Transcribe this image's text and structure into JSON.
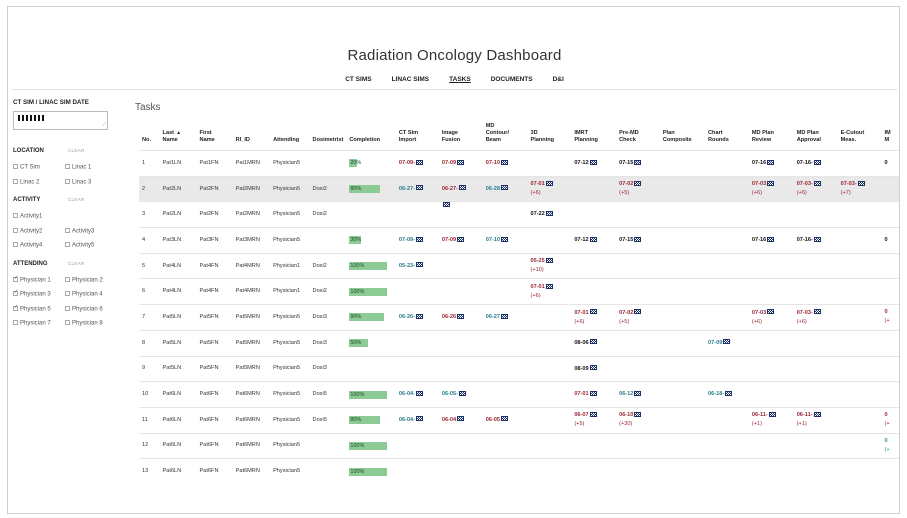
{
  "title": "Radiation Oncology Dashboard",
  "nav": [
    {
      "label": "CT SIMS",
      "active": false
    },
    {
      "label": "LINAC SIMS",
      "active": false
    },
    {
      "label": "TASKS",
      "active": true
    },
    {
      "label": "DOCUMENTS",
      "active": false
    },
    {
      "label": "D&I",
      "active": false
    }
  ],
  "sidebar": {
    "date_heading": "CT SIM / LINAC SIM DATE",
    "location": {
      "title": "LOCATION",
      "clear": "CLEAR",
      "options": [
        {
          "label": "CT Sim",
          "checked": false
        },
        {
          "label": "Linac 1",
          "checked": false
        },
        {
          "label": "Linac 2",
          "checked": false
        },
        {
          "label": "Linac 3",
          "checked": false
        }
      ]
    },
    "activity": {
      "title": "ACTIVITY",
      "clear": "CLEAR",
      "options": [
        {
          "label": "Activity1",
          "checked": false
        },
        {
          "label": "",
          "checked": null
        },
        {
          "label": "Activity2",
          "checked": false
        },
        {
          "label": "Activity3",
          "checked": false
        },
        {
          "label": "Activity4",
          "checked": false
        },
        {
          "label": "Activity5",
          "checked": false
        }
      ]
    },
    "attending": {
      "title": "ATTENDING",
      "clear": "CLEAR",
      "options": [
        {
          "label": "Physician 1",
          "checked": true
        },
        {
          "label": "Physician 2",
          "checked": false
        },
        {
          "label": "Physician 3",
          "checked": true
        },
        {
          "label": "Physician 4",
          "checked": false
        },
        {
          "label": "Physician 5",
          "checked": true
        },
        {
          "label": "Physician 6",
          "checked": false
        },
        {
          "label": "Physician 7",
          "checked": false
        },
        {
          "label": "Physician 8",
          "checked": false
        }
      ]
    }
  },
  "main": {
    "heading": "Tasks",
    "columns": [
      {
        "key": "no",
        "label": [
          "No."
        ],
        "w": 21
      },
      {
        "key": "last",
        "label": [
          "Last",
          "Name"
        ],
        "w": 38,
        "sort": "▲"
      },
      {
        "key": "first",
        "label": [
          "First",
          "Name"
        ],
        "w": 37
      },
      {
        "key": "ri",
        "label": [
          "RI_ID"
        ],
        "w": 38
      },
      {
        "key": "att",
        "label": [
          "Attending"
        ],
        "w": 40
      },
      {
        "key": "dosi",
        "label": [
          "Dosimetrist"
        ],
        "w": 36
      },
      {
        "key": "comp",
        "label": [
          "Completion"
        ],
        "w": 50
      },
      {
        "key": "ctsim",
        "label": [
          "CT Sim",
          "Import"
        ],
        "w": 44
      },
      {
        "key": "imgfus",
        "label": [
          "Image",
          "Fusion"
        ],
        "w": 45
      },
      {
        "key": "mdcont",
        "label": [
          "MD",
          "Contour/",
          "Beam"
        ],
        "w": 46
      },
      {
        "key": "plan3d",
        "label": [
          "3D",
          "Planning"
        ],
        "w": 45
      },
      {
        "key": "imrt",
        "label": [
          "IMRT",
          "Planning"
        ],
        "w": 46
      },
      {
        "key": "premd",
        "label": [
          "Pre-MD",
          "Check"
        ],
        "w": 45
      },
      {
        "key": "plancomp",
        "label": [
          "Plan",
          "Composite"
        ],
        "w": 46
      },
      {
        "key": "chart",
        "label": [
          "Chart",
          "Rounds"
        ],
        "w": 45
      },
      {
        "key": "mdreview",
        "label": [
          "MD Plan",
          "Review"
        ],
        "w": 46
      },
      {
        "key": "mdapprove",
        "label": [
          "MD Plan",
          "Approval"
        ],
        "w": 45
      },
      {
        "key": "ecut",
        "label": [
          "E-Cutout",
          "Meas."
        ],
        "w": 45
      },
      {
        "key": "im",
        "label": [
          "IM",
          "M"
        ],
        "w": 20
      }
    ],
    "rows": [
      {
        "shaded": false,
        "no": "1",
        "last": "Pat1LN",
        "first": "Pat1FN",
        "ri": "Pat1MRN",
        "att": "Physician5",
        "dosi": "",
        "comp": 20,
        "ctsim": {
          "d": "07-09-",
          "c": "red",
          "i": true
        },
        "imgfus": {
          "d": "07-09",
          "c": "red",
          "i": true
        },
        "mdcont": {
          "d": "07-10",
          "c": "red",
          "i": true
        },
        "imrt": {
          "d": "07-12",
          "c": "black",
          "i": true
        },
        "premd": {
          "d": "07-15",
          "c": "black",
          "i": true
        },
        "mdreview": {
          "d": "07-16",
          "c": "black",
          "i": true
        },
        "mdapprove": {
          "d": "07-16-",
          "c": "black",
          "i": true
        },
        "im": {
          "d": "0",
          "c": "black"
        }
      },
      {
        "shaded": true,
        "no": "2",
        "last": "Pat2LN",
        "first": "Pat2FN",
        "ri": "Pat2MRN",
        "att": "Physician5",
        "dosi": "Dosi2",
        "comp": 80,
        "ctsim": {
          "d": "06-27-",
          "c": "teal",
          "i": true
        },
        "imgfus": {
          "d": "06-27-",
          "c": "red",
          "i": true
        },
        "mdcont": {
          "d": "06-28",
          "c": "teal",
          "i": true
        },
        "plan3d": {
          "d": "07-01",
          "c": "red",
          "i": true,
          "s": "(+6)"
        },
        "premd": {
          "d": "07-02",
          "c": "red",
          "i": true,
          "s": "(+5)"
        },
        "mdreview": {
          "d": "07-03",
          "c": "red",
          "i": true,
          "s": "(+6)"
        },
        "mdapprove": {
          "d": "07-03-",
          "c": "red",
          "i": true,
          "s": "(+6)"
        },
        "ecut": {
          "d": "07-03-",
          "c": "red",
          "i": true,
          "s": "(+7)"
        }
      },
      {
        "shaded": false,
        "no": "3",
        "last": "Pat2LN",
        "first": "Pat2FN",
        "ri": "Pat2MRN",
        "att": "Physician5",
        "dosi": "Dosi2",
        "comp": null,
        "imgfus": {
          "d": "",
          "c": "black",
          "i": true,
          "top": true
        },
        "plan3d": {
          "d": "07-22",
          "c": "black",
          "i": true
        }
      },
      {
        "shaded": false,
        "no": "4",
        "last": "Pat3LN",
        "first": "Pat3FN",
        "ri": "Pat3MRN",
        "att": "Physician5",
        "dosi": "",
        "comp": 30,
        "ctsim": {
          "d": "07-09-",
          "c": "teal",
          "i": true
        },
        "imgfus": {
          "d": "07-09",
          "c": "red",
          "i": true
        },
        "mdcont": {
          "d": "07-10",
          "c": "teal",
          "i": true
        },
        "imrt": {
          "d": "07-12",
          "c": "black",
          "i": true
        },
        "premd": {
          "d": "07-15",
          "c": "black",
          "i": true
        },
        "mdreview": {
          "d": "07-16",
          "c": "black",
          "i": true
        },
        "mdapprove": {
          "d": "07-16-",
          "c": "black",
          "i": true
        },
        "im": {
          "d": "0",
          "c": "black"
        }
      },
      {
        "shaded": false,
        "no": "5",
        "last": "Pat4LN",
        "first": "Pat4FN",
        "ri": "Pat4MRN",
        "att": "Physician1",
        "dosi": "Dosi2",
        "comp": 100,
        "ctsim": {
          "d": "05-23-",
          "c": "teal",
          "i": true
        },
        "plan3d": {
          "d": "05-25",
          "c": "red",
          "i": true,
          "s": "(+10)"
        }
      },
      {
        "shaded": false,
        "no": "6",
        "last": "Pat4LN",
        "first": "Pat4FN",
        "ri": "Pat4MRN",
        "att": "Physician1",
        "dosi": "Dosi2",
        "comp": 100,
        "plan3d": {
          "d": "07-01",
          "c": "red",
          "i": true,
          "s": "(+6)"
        }
      },
      {
        "shaded": false,
        "no": "7",
        "last": "Pat5LN",
        "first": "Pat5FN",
        "ri": "Pat5MRN",
        "att": "Physician5",
        "dosi": "Dosi3",
        "comp": 90,
        "ctsim": {
          "d": "06-26-",
          "c": "teal",
          "i": true
        },
        "imgfus": {
          "d": "06-26",
          "c": "red",
          "i": true
        },
        "mdcont": {
          "d": "06-27",
          "c": "teal",
          "i": true
        },
        "imrt": {
          "d": "07-01",
          "c": "red",
          "i": true,
          "s": "(+6)"
        },
        "premd": {
          "d": "07-02",
          "c": "red",
          "i": true,
          "s": "(+5)"
        },
        "mdreview": {
          "d": "07-03",
          "c": "red",
          "i": true,
          "s": "(+6)"
        },
        "mdapprove": {
          "d": "07-03-",
          "c": "red",
          "i": true,
          "s": "(+6)"
        },
        "im": {
          "d": "0",
          "c": "red",
          "s": "(+"
        }
      },
      {
        "shaded": false,
        "no": "8",
        "last": "Pat5LN",
        "first": "Pat5FN",
        "ri": "Pat5MRN",
        "att": "Physician5",
        "dosi": "Dosi3",
        "comp": 50,
        "imrt": {
          "d": "08-06",
          "c": "black",
          "i": true
        },
        "chart": {
          "d": "07-09",
          "c": "teal",
          "i": true
        }
      },
      {
        "shaded": false,
        "no": "9",
        "last": "Pat5LN",
        "first": "Pat5FN",
        "ri": "Pat5MRN",
        "att": "Physician5",
        "dosi": "Dosi3",
        "comp": null,
        "imrt": {
          "d": "08-09",
          "c": "black",
          "i": true
        }
      },
      {
        "shaded": false,
        "no": "10",
        "last": "Pat6LN",
        "first": "Pat6FN",
        "ri": "Pat6MRN",
        "att": "Physician5",
        "dosi": "Dosi5",
        "comp": 100,
        "ctsim": {
          "d": "06-04-",
          "c": "teal",
          "i": true
        },
        "imgfus": {
          "d": "06-05-",
          "c": "teal",
          "i": true
        },
        "imrt": {
          "d": "07-01",
          "c": "red",
          "i": true
        },
        "premd": {
          "d": "06-12",
          "c": "teal",
          "i": true
        },
        "chart": {
          "d": "06-18-",
          "c": "teal",
          "i": true
        }
      },
      {
        "shaded": false,
        "no": "11",
        "last": "Pat6LN",
        "first": "Pat6FN",
        "ri": "Pat6MRN",
        "att": "Physician5",
        "dosi": "Dosi5",
        "comp": 80,
        "ctsim": {
          "d": "06-04-",
          "c": "teal",
          "i": true
        },
        "imgfus": {
          "d": "06-04",
          "c": "red",
          "i": true
        },
        "mdcont": {
          "d": "06-05",
          "c": "red",
          "i": true
        },
        "imrt": {
          "d": "06-07",
          "c": "red",
          "i": true,
          "s": "(+5)"
        },
        "premd": {
          "d": "06-10",
          "c": "red",
          "i": true,
          "s": "(+30)"
        },
        "mdreview": {
          "d": "06-11-",
          "c": "red",
          "i": true,
          "s": "(+1)"
        },
        "mdapprove": {
          "d": "06-11-",
          "c": "red",
          "i": true,
          "s": "(+1)"
        },
        "im": {
          "d": "0",
          "c": "red",
          "s": "(+"
        }
      },
      {
        "shaded": false,
        "no": "12",
        "last": "Pat6LN",
        "first": "Pat6FN",
        "ri": "Pat6MRN",
        "att": "Physician5",
        "dosi": "",
        "comp": 100,
        "im": {
          "d": "0",
          "c": "green",
          "s": "(+"
        }
      },
      {
        "shaded": false,
        "no": "13",
        "last": "Pat6LN",
        "first": "Pat6FN",
        "ri": "Pat6MRN",
        "att": "Physician5",
        "dosi": "",
        "comp": 100
      }
    ]
  }
}
